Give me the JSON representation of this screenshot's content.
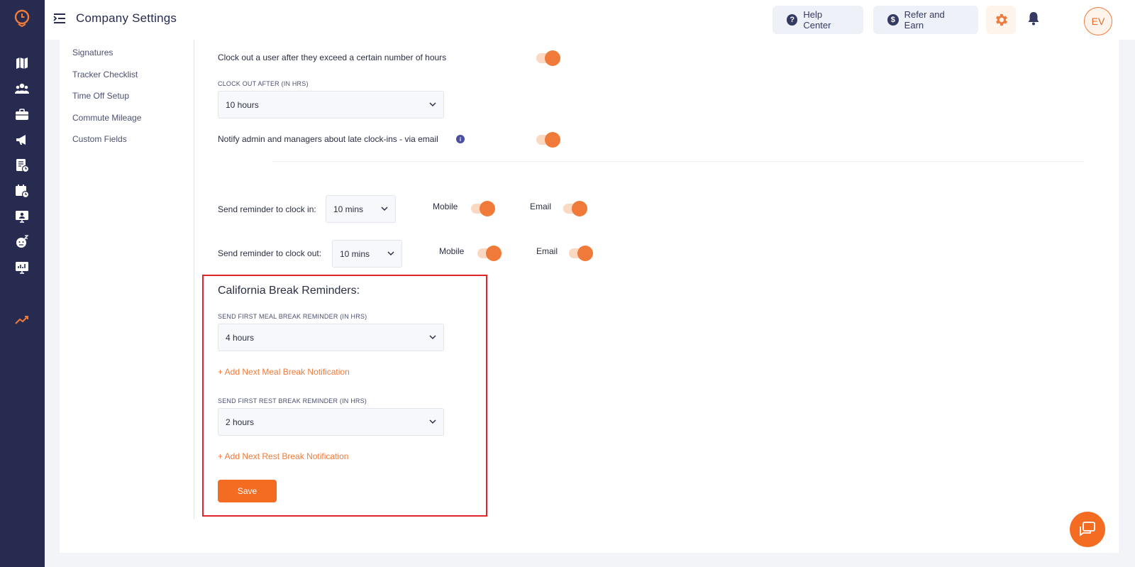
{
  "header": {
    "title": "Company Settings",
    "help_label": "Help Center",
    "refer_label": "Refer and Earn",
    "avatar_initials": "EV"
  },
  "colors": {
    "accent": "#f07a3a",
    "rail": "#262b4f",
    "highlight_border": "#e0262b"
  },
  "sidebar_icons": [
    "logo-icon",
    "map-icon",
    "team-icon",
    "briefcase-icon",
    "megaphone-icon",
    "timesheet-icon",
    "schedule-icon",
    "kiosk-icon",
    "time-off-icon",
    "reports-icon",
    "trending-icon"
  ],
  "subnav": {
    "items": [
      {
        "label": "Signatures"
      },
      {
        "label": "Tracker Checklist"
      },
      {
        "label": "Time Off Setup"
      },
      {
        "label": "Commute Mileage"
      },
      {
        "label": "Custom Fields"
      }
    ]
  },
  "settings": {
    "auto_clockout_label": "Clock out a user after they exceed a certain number of hours",
    "auto_clockout_enabled": true,
    "clockout_after_label": "CLOCK OUT AFTER (IN HRS)",
    "clockout_after_value": "10 hours",
    "notify_late_label": "Notify admin and managers about late clock-ins - via email",
    "notify_late_enabled": true,
    "reminder_in": {
      "label": "Send reminder to clock in:",
      "value": "10 mins",
      "mobile_label": "Mobile",
      "mobile_enabled": true,
      "email_label": "Email",
      "email_enabled": true
    },
    "reminder_out": {
      "label": "Send reminder to clock out:",
      "value": "10 mins",
      "mobile_label": "Mobile",
      "mobile_enabled": true,
      "email_label": "Email",
      "email_enabled": true
    }
  },
  "california": {
    "title": "California Break Reminders:",
    "meal_label": "SEND FIRST MEAL BREAK REMINDER (IN HRS)",
    "meal_value": "4 hours",
    "add_meal_label": "+ Add Next Meal Break Notification",
    "rest_label": "SEND FIRST REST BREAK REMINDER (IN HRS)",
    "rest_value": "2 hours",
    "add_rest_label": "+ Add Next Rest Break Notification",
    "save_label": "Save"
  }
}
